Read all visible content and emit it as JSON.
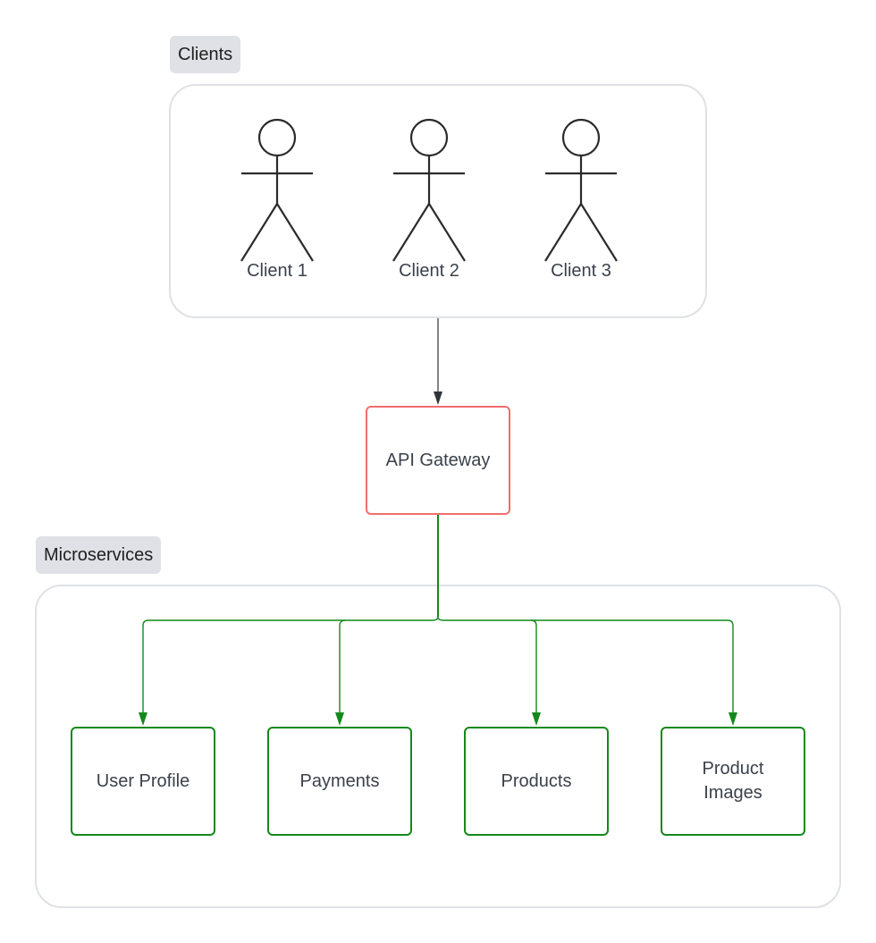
{
  "diagram": {
    "groups": {
      "clients": {
        "label": "Clients"
      },
      "microservices": {
        "label": "Microservices"
      }
    },
    "actors": [
      {
        "label": "Client 1"
      },
      {
        "label": "Client 2"
      },
      {
        "label": "Client 3"
      }
    ],
    "gateway": {
      "label": "API Gateway",
      "border_color": "#f16d6d"
    },
    "services": [
      {
        "label": "User Profile"
      },
      {
        "label": "Payments"
      },
      {
        "label": "Products"
      },
      {
        "label": "Product\nImages"
      }
    ],
    "edges": [
      {
        "from": "Clients",
        "to": "API Gateway",
        "color": "#2f343b"
      },
      {
        "from": "API Gateway",
        "to": "User Profile",
        "color": "#13891b"
      },
      {
        "from": "API Gateway",
        "to": "Payments",
        "color": "#13891b"
      },
      {
        "from": "API Gateway",
        "to": "Products",
        "color": "#13891b"
      },
      {
        "from": "API Gateway",
        "to": "Product Images",
        "color": "#13891b"
      }
    ],
    "colors": {
      "service_border": "#13891b",
      "group_border": "#dfe1e6",
      "label_tag_bg": "#dfe1e6"
    }
  }
}
